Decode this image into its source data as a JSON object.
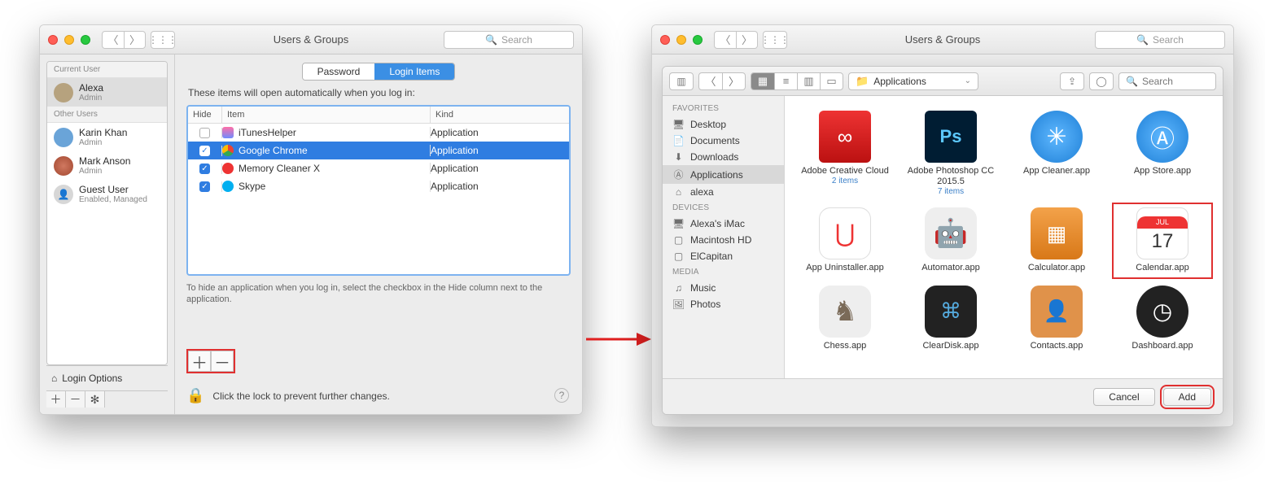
{
  "left": {
    "title": "Users & Groups",
    "search_placeholder": "Search",
    "sidebar": {
      "current_h": "Current User",
      "other_h": "Other Users",
      "users": [
        {
          "name": "Alexa",
          "sub": "Admin"
        },
        {
          "name": "Karin Khan",
          "sub": "Admin"
        },
        {
          "name": "Mark Anson",
          "sub": "Admin"
        },
        {
          "name": "Guest User",
          "sub": "Enabled, Managed"
        }
      ],
      "login_options": "Login Options"
    },
    "tabs": {
      "password": "Password",
      "login_items": "Login Items"
    },
    "subtitle": "These items will open automatically when you log in:",
    "cols": {
      "hide": "Hide",
      "item": "Item",
      "kind": "Kind"
    },
    "rows": [
      {
        "checked": false,
        "name": "iTunesHelper",
        "kind": "Application"
      },
      {
        "checked": true,
        "name": "Google Chrome",
        "kind": "Application"
      },
      {
        "checked": true,
        "name": "Memory Cleaner X",
        "kind": "Application"
      },
      {
        "checked": true,
        "name": "Skype",
        "kind": "Application"
      }
    ],
    "hint": "To hide an application when you log in, select the checkbox in the Hide column next to the application.",
    "lock_text": "Click the lock to prevent further changes."
  },
  "right": {
    "title": "Users & Groups",
    "search_placeholder": "Search",
    "location": "Applications",
    "fav_h": "Favorites",
    "dev_h": "Devices",
    "media_h": "Media",
    "fav": [
      {
        "label": "Desktop"
      },
      {
        "label": "Documents"
      },
      {
        "label": "Downloads"
      },
      {
        "label": "Applications"
      },
      {
        "label": "alexa"
      }
    ],
    "dev": [
      {
        "label": "Alexa's iMac"
      },
      {
        "label": "Macintosh HD"
      },
      {
        "label": "ElCapitan"
      }
    ],
    "media": [
      {
        "label": "Music"
      },
      {
        "label": "Photos"
      }
    ],
    "apps": [
      {
        "label": "Adobe Creative Cloud",
        "sub": "2 items"
      },
      {
        "label": "Adobe Photoshop CC 2015.5",
        "sub": "7 items"
      },
      {
        "label": "App Cleaner.app",
        "sub": ""
      },
      {
        "label": "App Store.app",
        "sub": ""
      },
      {
        "label": "App Uninstaller.app",
        "sub": ""
      },
      {
        "label": "Automator.app",
        "sub": ""
      },
      {
        "label": "Calculator.app",
        "sub": ""
      },
      {
        "label": "Calendar.app",
        "sub": ""
      },
      {
        "label": "Chess.app",
        "sub": ""
      },
      {
        "label": "ClearDisk.app",
        "sub": ""
      },
      {
        "label": "Contacts.app",
        "sub": ""
      },
      {
        "label": "Dashboard.app",
        "sub": ""
      }
    ],
    "cal": {
      "month": "JUL",
      "day": "17"
    },
    "cancel": "Cancel",
    "add": "Add"
  }
}
